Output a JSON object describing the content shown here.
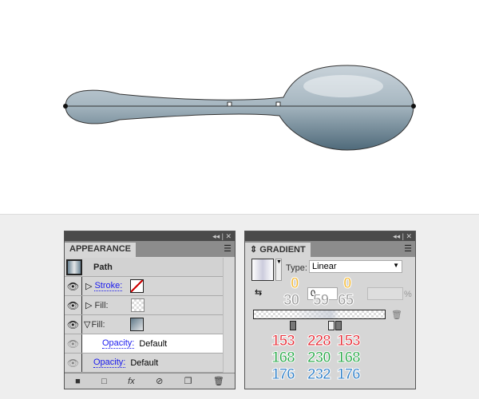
{
  "appearance": {
    "tab": "APPEARANCE",
    "title": "Path",
    "rows": [
      {
        "label": "Stroke:"
      },
      {
        "label": "Fill:"
      },
      {
        "label": "Fill:"
      }
    ],
    "opacity_label": "Opacity:",
    "opacity_value": "Default",
    "opacity2_label": "Opacity:",
    "opacity2_value": "Default",
    "fx": "fx"
  },
  "gradient": {
    "tab": "GRADIENT",
    "type_label": "Type:",
    "type_value": "Linear",
    "angle_value": "0",
    "percent": "%",
    "annotations": {
      "opacity_left": "0",
      "opacity_right": "0",
      "loc1": "30",
      "loc2": "59",
      "loc3": "65"
    },
    "colors": {
      "r": [
        "153",
        "228",
        "153"
      ],
      "g": [
        "168",
        "230",
        "168"
      ],
      "b": [
        "176",
        "232",
        "176"
      ]
    }
  },
  "titlebar_icons": "◂◂ | ✕",
  "colors": {
    "red": "#e8303a",
    "green": "#2aaa4a",
    "blue": "#2f7fc8",
    "spoon_dark": "#6f8a98",
    "spoon_light": "#e4e6e8"
  }
}
